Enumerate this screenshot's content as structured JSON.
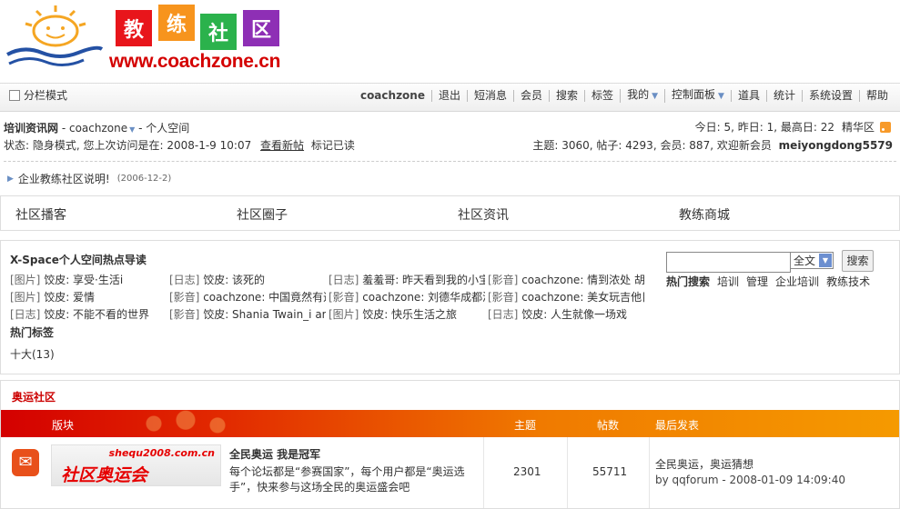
{
  "logo": {
    "chars": [
      "教",
      "练",
      "社",
      "区"
    ],
    "char_colors": [
      "#e8151b",
      "#f7941d",
      "#2bb24c",
      "#8e2fb5"
    ],
    "url": "www.coachzone.cn"
  },
  "menubar": {
    "split_mode": "分栏模式",
    "items": [
      "coachzone",
      "退出",
      "短消息",
      "会员",
      "搜索",
      "标签",
      "我的",
      "控制面板",
      "道具",
      "统计",
      "系统设置",
      "帮助"
    ]
  },
  "nav": {
    "site": "培训资讯网",
    "sep1": " - ",
    "user": "coachzone",
    "sep2": " - ",
    "space": "个人空间",
    "stats_right": "今日: 5, 昨日: 1, 最高日: 22",
    "digest": "精华区",
    "status_text": "状态: 隐身模式, 您上次访问是在: 2008-1-9 10:07",
    "view_new": "查看新帖",
    "mark_read": "标记已读",
    "forum_stats": "主题: 3060, 帖子: 4293, 会员: 887, 欢迎新会员",
    "new_member": "meiyongdong5579"
  },
  "announcement": {
    "title": "企业教练社区说明!",
    "date": "(2006-12-2)"
  },
  "tabs": [
    "社区播客",
    "社区圈子",
    "社区资讯",
    "教练商城"
  ],
  "xspace": {
    "title": "X-Space个人空间热点导读",
    "rows": [
      [
        {
          "tag": "[图片]",
          "text": " 饺皮: 享受·生活i"
        },
        {
          "tag": "[日志]",
          "text": " 饺皮: 该死的"
        },
        {
          "tag": "[日志]",
          "text": " 羞羞哥: 昨天看到我的小宝"
        },
        {
          "tag": "[影音]",
          "text": " coachzone: 情到浓处  胡"
        }
      ],
      [
        {
          "tag": "[图片]",
          "text": " 饺皮: 爱情"
        },
        {
          "tag": "[影音]",
          "text": " coachzone: 中国竟然有这"
        },
        {
          "tag": "[影音]",
          "text": " coachzone: 刘德华成都演"
        },
        {
          "tag": "[影音]",
          "text": " coachzone: 美女玩吉他目"
        }
      ],
      [
        {
          "tag": "[日志]",
          "text": " 饺皮: 不能不看的世界"
        },
        {
          "tag": "[影音]",
          "text": " 饺皮: Shania Twain_i am"
        },
        {
          "tag": "[图片]",
          "text": " 饺皮: 快乐生活之旅"
        },
        {
          "tag": "[日志]",
          "text": " 饺皮: 人生就像一场戏"
        }
      ]
    ],
    "hot_tags_title": "热门标签",
    "hot_tags": "十大(13)",
    "search": {
      "input_value": "",
      "select_value": "全文",
      "button": "搜索",
      "links": [
        "热门搜索",
        "培训",
        "管理",
        "企业培训",
        "教练技术"
      ]
    }
  },
  "forum": {
    "category": "奥运社区",
    "headers": {
      "board": "版块",
      "topics": "主题",
      "posts": "帖数",
      "last": "最后发表"
    },
    "rows": [
      {
        "banner_top": "shequ2008.com.cn",
        "banner_main": "社区奥运会",
        "name": "全民奥运  我是冠军",
        "description": "每个论坛都是“参赛国家”，每个用户都是“奥运选手”，快来参与这场全民的奥运盛会吧",
        "topics": "2301",
        "posts": "55711",
        "last_title": "全民奥运，奥运猜想",
        "last_by": "by qqforum - 2008-01-09 14:09:40"
      }
    ]
  }
}
